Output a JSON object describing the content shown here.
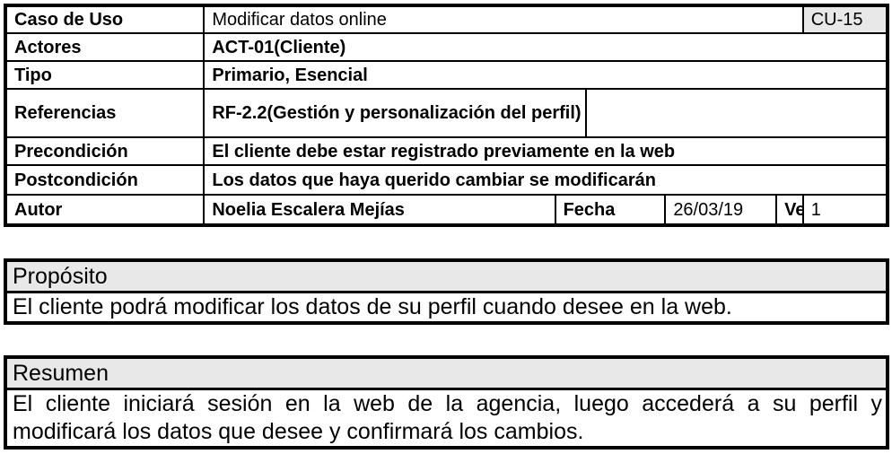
{
  "header": {
    "caso_label": "Caso de Uso",
    "caso_value": "Modificar datos online",
    "caso_id": "CU-15",
    "actores_label": "Actores",
    "actores_value": "ACT-01(Cliente)",
    "tipo_label": "Tipo",
    "tipo_value": "Primario, Esencial",
    "referencias_label": "Referencias",
    "referencias_value": "RF-2.2(Gestión y personalización del perfil)",
    "precondicion_label": "Precondición",
    "precondicion_value": "El cliente debe estar registrado previamente en la web",
    "postcondicion_label": "Postcondición",
    "postcondicion_value": "Los datos que haya querido cambiar se modificarán",
    "autor_label": "Autor",
    "autor_value": "Noelia Escalera Mejías",
    "fecha_label": "Fecha",
    "fecha_value": "26/03/19",
    "version_label": "Versión",
    "version_value": "1"
  },
  "proposito": {
    "title": "Propósito",
    "text": "El cliente podrá modificar los datos de su perfil cuando desee en la web."
  },
  "resumen": {
    "title": "Resumen",
    "text": "El cliente iniciará sesión en la web de la agencia, luego accederá a su perfil y modificará los datos que desee y confirmará los cambios."
  }
}
